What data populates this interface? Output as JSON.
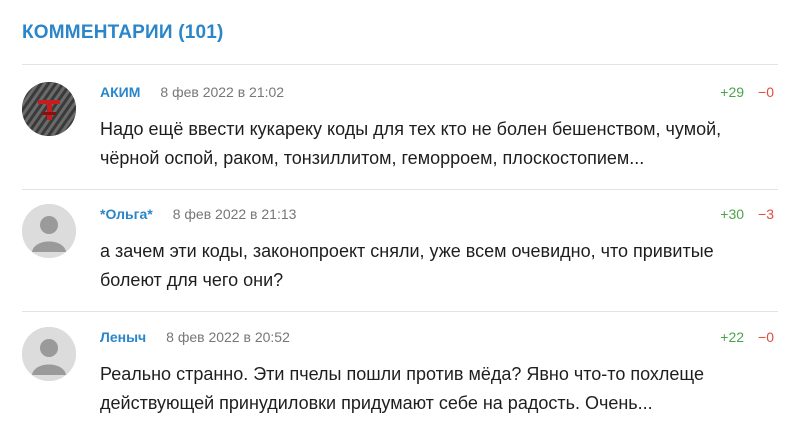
{
  "section": {
    "title": "КОММЕНТАРИИ (101)"
  },
  "comments": [
    {
      "author": "АКИМ",
      "date": "8 фев 2022 в 21:02",
      "up": "+29",
      "down": "−0",
      "text": "Надо ещё ввести кукареку коды для тех кто не болен бешенством, чумой, чёрной оспой, раком, тонзиллитом, геморроем, плоскостопием...",
      "avatar": "custom-image"
    },
    {
      "author": "*Ольга*",
      "date": "8 фев 2022 в 21:13",
      "up": "+30",
      "down": "−3",
      "text": "а зачем эти коды, законопроект сняли, уже всем очевидно, что привитые болеют для чего они?",
      "avatar": "default-user-icon"
    },
    {
      "author": "Леныч",
      "date": "8 фев 2022 в 20:52",
      "up": "+22",
      "down": "−0",
      "text": "Реально странно. Эти пчелы пошли против мёда? Явно что-то похлеще действующей принудиловки придумают себе на радость. Очень...",
      "avatar": "default-user-icon"
    }
  ],
  "colors": {
    "accent": "#2a86c9",
    "upvote": "#4aa54a",
    "downvote": "#e24a3b",
    "date": "#777777",
    "divider": "#e3e3e3"
  }
}
